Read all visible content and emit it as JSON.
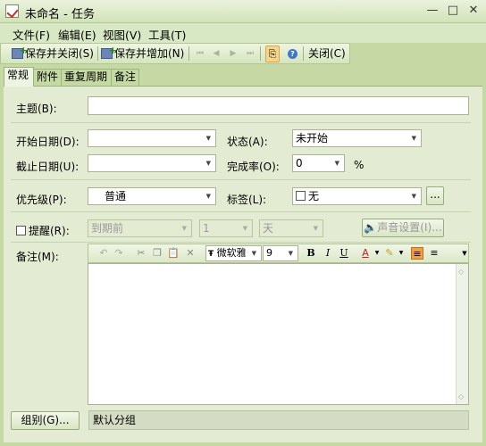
{
  "window": {
    "title": "未命名 - 任务",
    "controls": {
      "minimize": "—",
      "maximize": "□",
      "close": "✕"
    }
  },
  "menu": [
    "文件(F)",
    "编辑(E)",
    "视图(V)",
    "工具(T)"
  ],
  "toolbar": {
    "save_close": "保存并关闭(S)",
    "save_add": "保存并增加(N)",
    "close": "关闭(C)",
    "help": "?"
  },
  "tabs": [
    "常规",
    "附件",
    "重复周期",
    "备注"
  ],
  "form": {
    "subject_label": "主题(B):",
    "subject_value": "",
    "start_date_label": "开始日期(D):",
    "start_date_value": "",
    "due_date_label": "截止日期(U):",
    "due_date_value": "",
    "status_label": "状态(A):",
    "status_value": "未开始",
    "completion_label": "完成率(O):",
    "completion_value": "0",
    "percent_sign": "%",
    "priority_label": "优先级(P):",
    "priority_value": "普通",
    "tags_label": "标签(L):",
    "tags_value": "无",
    "tags_more": "...",
    "reminder_label": "提醒(R):",
    "reminder_when": "到期前",
    "reminder_amount": "1",
    "reminder_unit": "天",
    "sound_settings": "声音设置(I)...",
    "notes_label": "备注(M):",
    "font_name": "微软雅",
    "font_size": "9",
    "group_button": "组别(G)...",
    "group_value": "默认分组"
  },
  "colors": {
    "window_bg": "#c6d8a4",
    "panel_bg": "#e3ecd3",
    "tab_active": "#eef4e4"
  }
}
